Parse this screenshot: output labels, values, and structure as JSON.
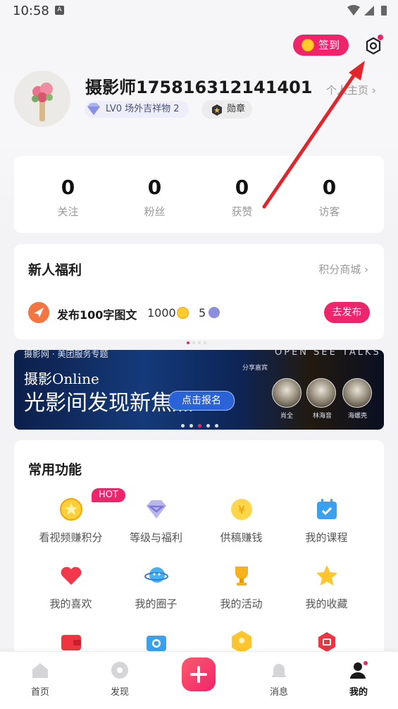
{
  "status_bar": {
    "time": "10:58",
    "notification_badge": "A"
  },
  "header": {
    "signin_label": "签到",
    "accent_color": "#f0246b"
  },
  "profile": {
    "username": "摄影师175816312141401",
    "home_link": "个人主页",
    "level": "LV0 场外吉祥物",
    "level_count": "2",
    "medal_label": "勋章"
  },
  "stats": [
    {
      "value": "0",
      "label": "关注"
    },
    {
      "value": "0",
      "label": "粉丝"
    },
    {
      "value": "0",
      "label": "获赞"
    },
    {
      "value": "0",
      "label": "访客"
    }
  ],
  "newbie": {
    "title": "新人福利",
    "more": "积分商城",
    "task_title": "发布100字图文",
    "task_points": "1000",
    "task_extra": "5",
    "task_button": "去发布"
  },
  "banner": {
    "logo_text": "摄影网  ·  美团服务专题",
    "open_talks": "OPEN SEE TALKS",
    "brand_line1": "摄影Online",
    "brand_line2": "光影间发现新焦点",
    "cta": "点击报名",
    "share_label": "分享嘉宾",
    "speakers": [
      "肖全",
      "林海音",
      "海螺壳"
    ]
  },
  "tools": {
    "title": "常用功能",
    "hot_badge": "HOT",
    "items": [
      {
        "label": "看视频赚积分",
        "icon": "coin-star-icon"
      },
      {
        "label": "等级与福利",
        "icon": "diamond-icon"
      },
      {
        "label": "供稿赚钱",
        "icon": "yen-coin-icon"
      },
      {
        "label": "我的课程",
        "icon": "calendar-icon"
      },
      {
        "label": "我的喜欢",
        "icon": "heart-icon"
      },
      {
        "label": "我的圈子",
        "icon": "planet-icon"
      },
      {
        "label": "我的活动",
        "icon": "trophy-icon"
      },
      {
        "label": "我的收藏",
        "icon": "star-icon"
      },
      {
        "label": "",
        "icon": "wallet-icon"
      },
      {
        "label": "",
        "icon": "camera-icon"
      },
      {
        "label": "",
        "icon": "hexagon-icon"
      },
      {
        "label": "",
        "icon": "red-hexagon-icon"
      }
    ]
  },
  "tabbar": {
    "items": [
      {
        "label": "首页",
        "icon": "home-icon"
      },
      {
        "label": "发现",
        "icon": "discover-icon"
      },
      {
        "label": "",
        "icon": "plus-icon"
      },
      {
        "label": "消息",
        "icon": "bell-icon"
      },
      {
        "label": "我的",
        "icon": "profile-icon"
      }
    ]
  }
}
